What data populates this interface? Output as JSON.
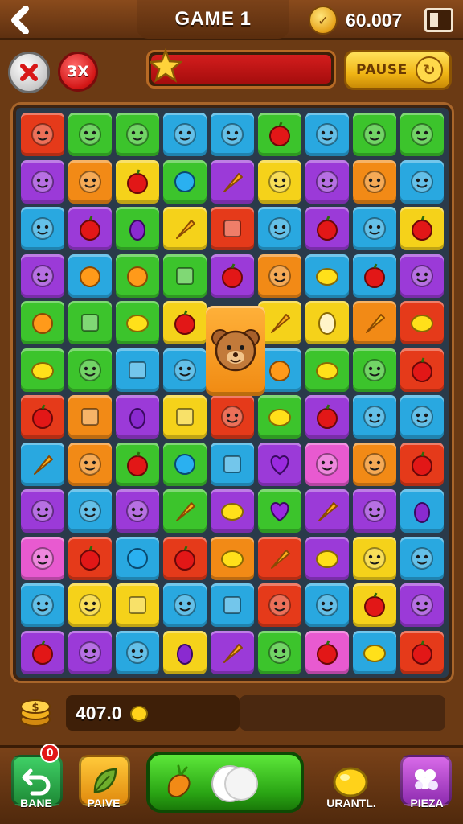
{
  "header": {
    "title": "GAME 1",
    "coins": "60.007",
    "back_icon": "back-arrow-icon",
    "menu_icon": "menu-icon"
  },
  "status_row": {
    "multiplier": "3X",
    "pause_label": "PAUSE",
    "progress_fill": 1.0,
    "colors": {
      "progress": "#c61414",
      "pause": "#f0b515"
    }
  },
  "board": {
    "rows": 12,
    "cols": 9,
    "tiles": [
      [
        "#e53a1a",
        "#3cc42c",
        "#3cc42c",
        "#29a8e0",
        "#29a8e0",
        "#3cc42c",
        "#29a8e0",
        "#3cc42c",
        "#3cc42c"
      ],
      [
        "#9b3ad8",
        "#f28a16",
        "#f5d21a",
        "#3cc42c",
        "#9b3ad8",
        "#f5d21a",
        "#9b3ad8",
        "#f28a16",
        "#29a8e0"
      ],
      [
        "#29a8e0",
        "#9b3ad8",
        "#3cc42c",
        "#f5d21a",
        "#e53a1a",
        "#29a8e0",
        "#9b3ad8",
        "#29a8e0",
        "#f5d21a"
      ],
      [
        "#9b3ad8",
        "#29a8e0",
        "#3cc42c",
        "#3cc42c",
        "#9b3ad8",
        "#f28a16",
        "#29a8e0",
        "#29a8e0",
        "#9b3ad8"
      ],
      [
        "#3cc42c",
        "#3cc42c",
        "#3cc42c",
        "#f5d21a",
        null,
        "#f5d21a",
        "#f5d21a",
        "#f28a16",
        "#e53a1a"
      ],
      [
        "#3cc42c",
        "#3cc42c",
        "#29a8e0",
        "#29a8e0",
        null,
        "#29a8e0",
        "#3cc42c",
        "#3cc42c",
        "#e53a1a"
      ],
      [
        "#e53a1a",
        "#f28a16",
        "#9b3ad8",
        "#f5d21a",
        "#e53a1a",
        "#3cc42c",
        "#9b3ad8",
        "#29a8e0",
        "#29a8e0"
      ],
      [
        "#29a8e0",
        "#f28a16",
        "#3cc42c",
        "#3cc42c",
        "#29a8e0",
        "#9b3ad8",
        "#e85ad0",
        "#f28a16",
        "#e53a1a"
      ],
      [
        "#9b3ad8",
        "#29a8e0",
        "#9b3ad8",
        "#3cc42c",
        "#9b3ad8",
        "#3cc42c",
        "#9b3ad8",
        "#9b3ad8",
        "#29a8e0"
      ],
      [
        "#e85ad0",
        "#e53a1a",
        "#29a8e0",
        "#e53a1a",
        "#f28a16",
        "#e53a1a",
        "#9b3ad8",
        "#f5d21a",
        "#29a8e0"
      ],
      [
        "#29a8e0",
        "#f5d21a",
        "#f5d21a",
        "#29a8e0",
        "#29a8e0",
        "#e53a1a",
        "#29a8e0",
        "#f5d21a",
        "#9b3ad8"
      ],
      [
        "#9b3ad8",
        "#9b3ad8",
        "#29a8e0",
        "#f5d21a",
        "#9b3ad8",
        "#3cc42c",
        "#e85ad0",
        "#29a8e0",
        "#e53a1a"
      ]
    ],
    "icons": [
      [
        "face-icon",
        "face-icon",
        "face-icon",
        "face-icon",
        "face-icon",
        "apple-icon",
        "face-icon",
        "face-icon",
        "face-icon"
      ],
      [
        "face-icon",
        "face-icon",
        "apple-icon",
        "ball-icon",
        "carrot-icon",
        "face-icon",
        "face-icon",
        "face-icon",
        "face-icon"
      ],
      [
        "face-icon",
        "apple-icon",
        "eggplant-icon",
        "carrot-icon",
        "gift-icon",
        "face-icon",
        "apple-icon",
        "face-icon",
        "apple-icon"
      ],
      [
        "face-icon",
        "orange-icon",
        "orange-icon",
        "cup-icon",
        "apple-icon",
        "face-icon",
        "lemon-icon",
        "apple-icon",
        "face-icon"
      ],
      [
        "orange-icon",
        "sign-icon",
        "lemon-icon",
        "apple-icon",
        null,
        "carrot-icon",
        "egg-icon",
        "carrot-icon",
        "lemon-icon"
      ],
      [
        "lemon-icon",
        "face-icon",
        "box-icon",
        "face-icon",
        null,
        "orange-icon",
        "lemon-icon",
        "face-icon",
        "apple-icon"
      ],
      [
        "apple-icon",
        "gem-icon",
        "grape-icon",
        "jar-icon",
        "face-icon",
        "lemon-icon",
        "apple-icon",
        "face-icon",
        "face-icon"
      ],
      [
        "carrot-icon",
        "face-icon",
        "apple-icon",
        "lime-icon",
        "candy-icon",
        "heart-icon",
        "face-icon",
        "face-icon",
        "apple-icon"
      ],
      [
        "face-icon",
        "face-icon",
        "face-icon",
        "carrot-icon",
        "lemon-icon",
        "heart-icon",
        "banana-icon",
        "face-icon",
        "eggplant-icon"
      ],
      [
        "face-icon",
        "apple-icon",
        "ball-icon",
        "apple-icon",
        "lemon-icon",
        "carrot-icon",
        "lemon-icon",
        "face-icon",
        "face-icon"
      ],
      [
        "face-icon",
        "face-icon",
        "chili-icon",
        "face-icon",
        "gem-icon",
        "face-icon",
        "face-icon",
        "apple-icon",
        "face-icon"
      ],
      [
        "apple-icon",
        "face-icon",
        "face-icon",
        "plum-icon",
        "carrot-icon",
        "face-icon",
        "apple-icon",
        "lemon-icon",
        "apple-icon"
      ]
    ],
    "special_tile": "bear-icon"
  },
  "score": {
    "value": "407.0",
    "icon": "coin-stack-icon"
  },
  "toolbar": {
    "items": [
      {
        "label": "BANE",
        "icon": "undo-arrow-icon",
        "badge": "0",
        "color": "#2bb34a"
      },
      {
        "label": "PAIVE",
        "icon": "leaf-icon",
        "color": "#f5a818"
      },
      {
        "label": "URANTL.",
        "icon": "lemon-icon"
      },
      {
        "label": "PIEZA",
        "icon": "grape-icon",
        "color": "#b548d8"
      }
    ],
    "play_icon": "play-toggle-icon"
  }
}
